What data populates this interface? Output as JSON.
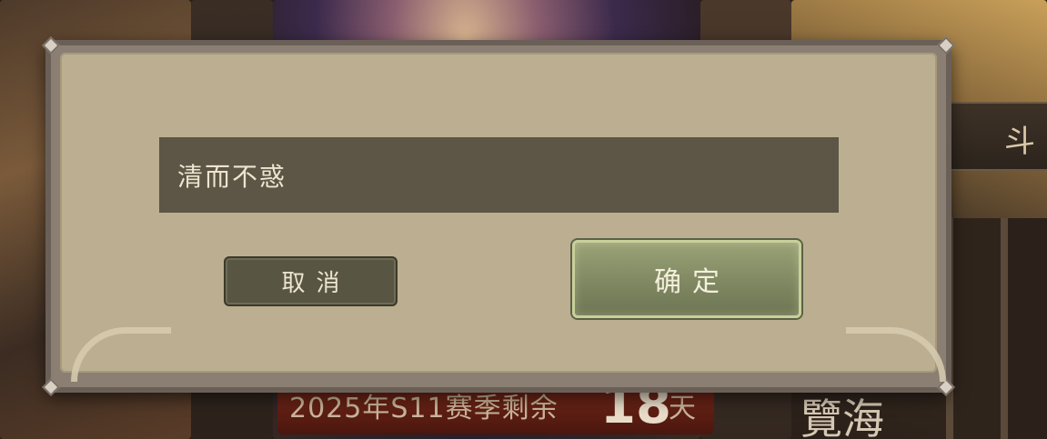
{
  "background": {
    "season_text": "2025年S11赛季剩余",
    "season_days": "18",
    "season_unit": "天",
    "side_char": "斗",
    "brush_text": "覽海"
  },
  "dialog": {
    "name_input": {
      "value": "清而不惑"
    },
    "cancel_label": "取消",
    "confirm_label": "确定"
  },
  "colors": {
    "dialog_body": "#bcae90",
    "input_bg": "#5d5545",
    "cancel_bg": "#585643",
    "confirm_bg": "#8a9268"
  }
}
